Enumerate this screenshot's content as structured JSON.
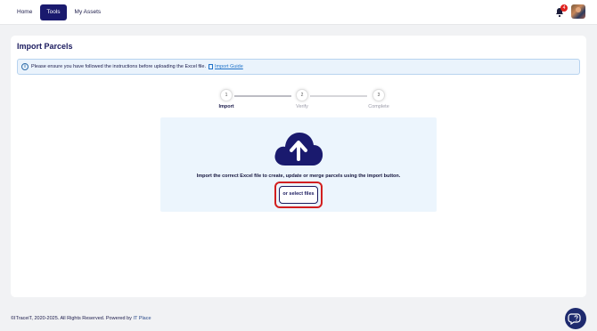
{
  "nav": {
    "items": [
      {
        "label": "Home"
      },
      {
        "label": "Tools"
      },
      {
        "label": "My Assets"
      }
    ],
    "notifications_count": "4"
  },
  "page": {
    "title": "Import Parcels",
    "info": {
      "text": "Please ensure you have followed the instructions before uploading the Excel file.",
      "link_label": "Import Guide"
    }
  },
  "stepper": {
    "steps": [
      {
        "number": "1",
        "label": "Import"
      },
      {
        "number": "2",
        "label": "Verify"
      },
      {
        "number": "3",
        "label": "Complete"
      }
    ]
  },
  "upload": {
    "instruction": "Import the correct Excel file to create, update or merge parcels using the import button.",
    "select_button": "or select files"
  },
  "footer": {
    "copyright": "©ITraceiT, 2020-2025. All Rights Reserved. Powered by",
    "brand": "IT Place"
  },
  "colors": {
    "accent": "#1a1a6e",
    "highlight": "#d21f1f",
    "info_bg": "#eaf3fc"
  },
  "icons": [
    "bell-icon",
    "info-icon",
    "document-icon",
    "cloud-upload-icon",
    "help-chat-icon"
  ]
}
